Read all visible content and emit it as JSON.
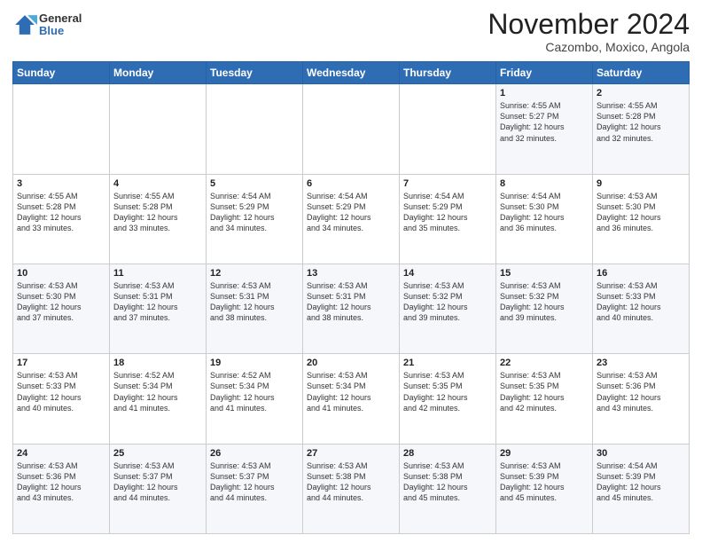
{
  "header": {
    "logo_general": "General",
    "logo_blue": "Blue",
    "month_title": "November 2024",
    "subtitle": "Cazombo, Moxico, Angola"
  },
  "weekdays": [
    "Sunday",
    "Monday",
    "Tuesday",
    "Wednesday",
    "Thursday",
    "Friday",
    "Saturday"
  ],
  "weeks": [
    [
      {
        "day": "",
        "text": ""
      },
      {
        "day": "",
        "text": ""
      },
      {
        "day": "",
        "text": ""
      },
      {
        "day": "",
        "text": ""
      },
      {
        "day": "",
        "text": ""
      },
      {
        "day": "1",
        "text": "Sunrise: 4:55 AM\nSunset: 5:27 PM\nDaylight: 12 hours\nand 32 minutes."
      },
      {
        "day": "2",
        "text": "Sunrise: 4:55 AM\nSunset: 5:28 PM\nDaylight: 12 hours\nand 32 minutes."
      }
    ],
    [
      {
        "day": "3",
        "text": "Sunrise: 4:55 AM\nSunset: 5:28 PM\nDaylight: 12 hours\nand 33 minutes."
      },
      {
        "day": "4",
        "text": "Sunrise: 4:55 AM\nSunset: 5:28 PM\nDaylight: 12 hours\nand 33 minutes."
      },
      {
        "day": "5",
        "text": "Sunrise: 4:54 AM\nSunset: 5:29 PM\nDaylight: 12 hours\nand 34 minutes."
      },
      {
        "day": "6",
        "text": "Sunrise: 4:54 AM\nSunset: 5:29 PM\nDaylight: 12 hours\nand 34 minutes."
      },
      {
        "day": "7",
        "text": "Sunrise: 4:54 AM\nSunset: 5:29 PM\nDaylight: 12 hours\nand 35 minutes."
      },
      {
        "day": "8",
        "text": "Sunrise: 4:54 AM\nSunset: 5:30 PM\nDaylight: 12 hours\nand 36 minutes."
      },
      {
        "day": "9",
        "text": "Sunrise: 4:53 AM\nSunset: 5:30 PM\nDaylight: 12 hours\nand 36 minutes."
      }
    ],
    [
      {
        "day": "10",
        "text": "Sunrise: 4:53 AM\nSunset: 5:30 PM\nDaylight: 12 hours\nand 37 minutes."
      },
      {
        "day": "11",
        "text": "Sunrise: 4:53 AM\nSunset: 5:31 PM\nDaylight: 12 hours\nand 37 minutes."
      },
      {
        "day": "12",
        "text": "Sunrise: 4:53 AM\nSunset: 5:31 PM\nDaylight: 12 hours\nand 38 minutes."
      },
      {
        "day": "13",
        "text": "Sunrise: 4:53 AM\nSunset: 5:31 PM\nDaylight: 12 hours\nand 38 minutes."
      },
      {
        "day": "14",
        "text": "Sunrise: 4:53 AM\nSunset: 5:32 PM\nDaylight: 12 hours\nand 39 minutes."
      },
      {
        "day": "15",
        "text": "Sunrise: 4:53 AM\nSunset: 5:32 PM\nDaylight: 12 hours\nand 39 minutes."
      },
      {
        "day": "16",
        "text": "Sunrise: 4:53 AM\nSunset: 5:33 PM\nDaylight: 12 hours\nand 40 minutes."
      }
    ],
    [
      {
        "day": "17",
        "text": "Sunrise: 4:53 AM\nSunset: 5:33 PM\nDaylight: 12 hours\nand 40 minutes."
      },
      {
        "day": "18",
        "text": "Sunrise: 4:52 AM\nSunset: 5:34 PM\nDaylight: 12 hours\nand 41 minutes."
      },
      {
        "day": "19",
        "text": "Sunrise: 4:52 AM\nSunset: 5:34 PM\nDaylight: 12 hours\nand 41 minutes."
      },
      {
        "day": "20",
        "text": "Sunrise: 4:53 AM\nSunset: 5:34 PM\nDaylight: 12 hours\nand 41 minutes."
      },
      {
        "day": "21",
        "text": "Sunrise: 4:53 AM\nSunset: 5:35 PM\nDaylight: 12 hours\nand 42 minutes."
      },
      {
        "day": "22",
        "text": "Sunrise: 4:53 AM\nSunset: 5:35 PM\nDaylight: 12 hours\nand 42 minutes."
      },
      {
        "day": "23",
        "text": "Sunrise: 4:53 AM\nSunset: 5:36 PM\nDaylight: 12 hours\nand 43 minutes."
      }
    ],
    [
      {
        "day": "24",
        "text": "Sunrise: 4:53 AM\nSunset: 5:36 PM\nDaylight: 12 hours\nand 43 minutes."
      },
      {
        "day": "25",
        "text": "Sunrise: 4:53 AM\nSunset: 5:37 PM\nDaylight: 12 hours\nand 44 minutes."
      },
      {
        "day": "26",
        "text": "Sunrise: 4:53 AM\nSunset: 5:37 PM\nDaylight: 12 hours\nand 44 minutes."
      },
      {
        "day": "27",
        "text": "Sunrise: 4:53 AM\nSunset: 5:38 PM\nDaylight: 12 hours\nand 44 minutes."
      },
      {
        "day": "28",
        "text": "Sunrise: 4:53 AM\nSunset: 5:38 PM\nDaylight: 12 hours\nand 45 minutes."
      },
      {
        "day": "29",
        "text": "Sunrise: 4:53 AM\nSunset: 5:39 PM\nDaylight: 12 hours\nand 45 minutes."
      },
      {
        "day": "30",
        "text": "Sunrise: 4:54 AM\nSunset: 5:39 PM\nDaylight: 12 hours\nand 45 minutes."
      }
    ]
  ]
}
